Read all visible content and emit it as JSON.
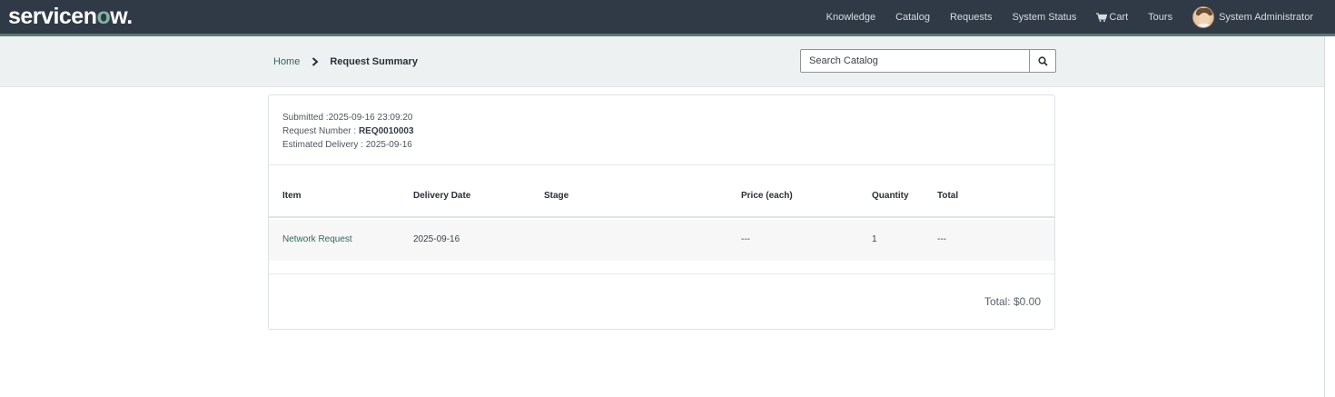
{
  "header": {
    "logo_pre": "servicen",
    "logo_o": "o",
    "logo_post": "w.",
    "nav": [
      "Knowledge",
      "Catalog",
      "Requests",
      "System Status"
    ],
    "cart_label": "Cart",
    "tours_label": "Tours",
    "user_name": "System Administrator",
    "colors": {
      "bar": "#303a46",
      "accent": "#81b5a1"
    }
  },
  "breadcrumb": {
    "home": "Home",
    "current": "Request Summary"
  },
  "search": {
    "placeholder": "Search Catalog",
    "button_icon": "search-icon"
  },
  "summary": {
    "submitted_label": "Submitted :",
    "submitted_value": "2025-09-16 23:09:20",
    "request_label": "Request Number : ",
    "request_value": "REQ0010003",
    "delivery_label": "Estimated Delivery : ",
    "delivery_value": "2025-09-16"
  },
  "table": {
    "columns": [
      "Item",
      "Delivery Date",
      "Stage",
      "Price (each)",
      "Quantity",
      "Total"
    ],
    "rows": [
      {
        "item": "Network Request",
        "delivery_date": "2025-09-16",
        "stage": "",
        "price": "---",
        "quantity": "1",
        "total": "---"
      }
    ]
  },
  "total_text": "Total: $0.00"
}
